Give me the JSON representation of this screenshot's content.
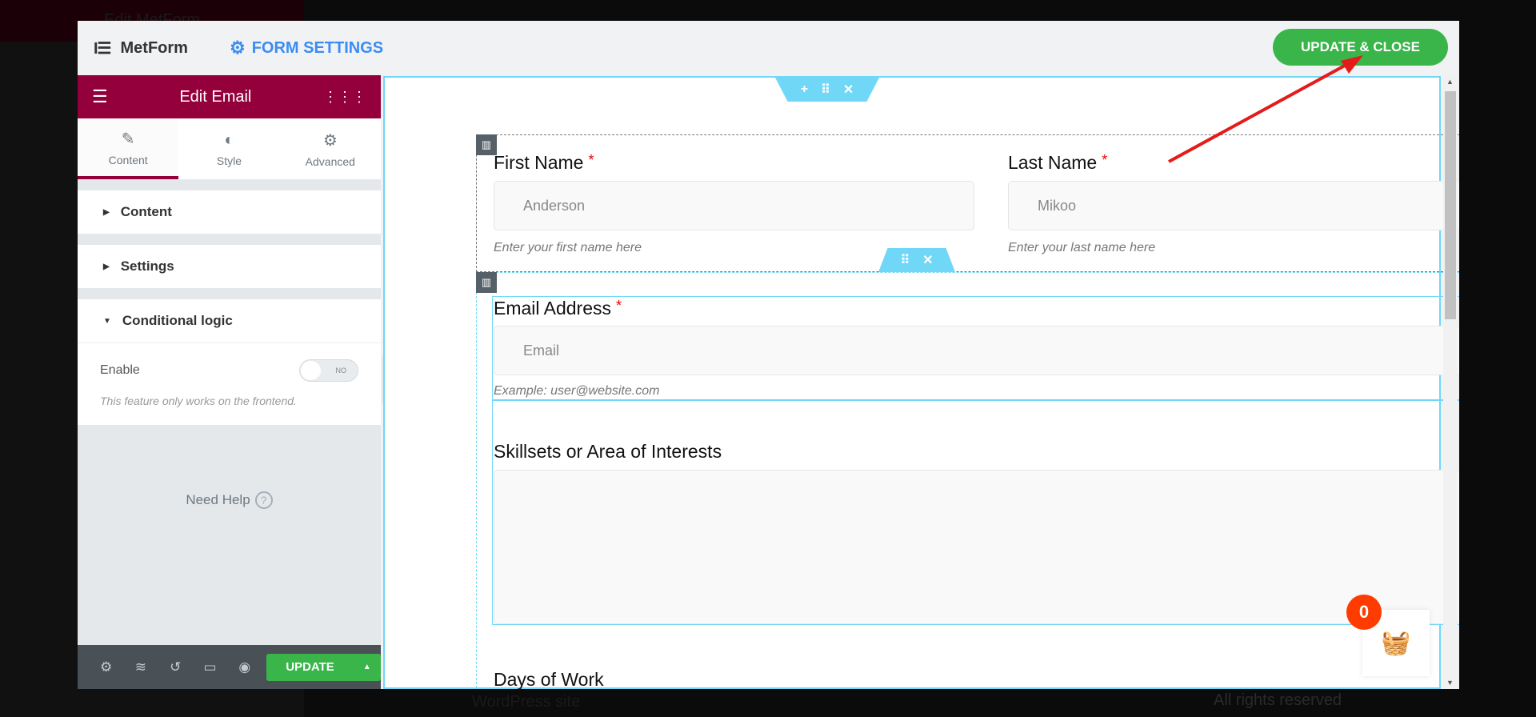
{
  "background": {
    "title": "Edit MetForm",
    "footer_text": "WordPress site",
    "rights": "All rights reserved"
  },
  "header": {
    "logo": "MetForm",
    "form_settings": "FORM SETTINGS",
    "update_close": "UPDATE & CLOSE"
  },
  "panel": {
    "title": "Edit Email",
    "tabs": [
      {
        "label": "Content",
        "icon": "pencil-icon"
      },
      {
        "label": "Style",
        "icon": "contrast-icon"
      },
      {
        "label": "Advanced",
        "icon": "gear-icon"
      }
    ],
    "sections": [
      "Content",
      "Settings",
      "Conditional logic"
    ],
    "enable_label": "Enable",
    "toggle_value": "NO",
    "toggle_on": false,
    "note": "This feature only works on the frontend.",
    "help": "Need Help",
    "help_icon": "?",
    "update": "UPDATE"
  },
  "form": {
    "first_name": {
      "label": "First Name",
      "required": "*",
      "value": "Anderson",
      "hint": "Enter your first name here"
    },
    "last_name": {
      "label": "Last Name",
      "required": "*",
      "value": "Mikoo",
      "hint": "Enter your last name here"
    },
    "email": {
      "label": "Email Address",
      "required": "*",
      "placeholder": "Email",
      "hint": "Example: user@website.com"
    },
    "skills": {
      "label": "Skillsets or Area of Interests"
    },
    "days": {
      "label": "Days of Work"
    }
  },
  "cart": {
    "count": "0"
  },
  "colors": {
    "accent": "#93003c",
    "green": "#39b54a",
    "handle": "#71d7f7",
    "link": "#3b8cf2",
    "badge": "#ff3c00",
    "arrow": "#e41b1b"
  }
}
